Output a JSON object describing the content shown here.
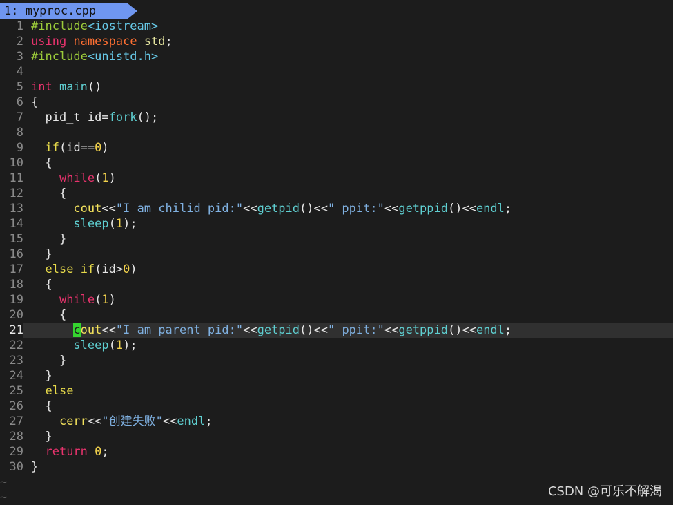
{
  "tab": {
    "label": "1: myproc.cpp"
  },
  "lines": [
    {
      "n": "1",
      "tokens": [
        {
          "t": "#include",
          "c": "pp"
        },
        {
          "t": "<iostream>",
          "c": "hdr"
        }
      ]
    },
    {
      "n": "2",
      "tokens": [
        {
          "t": "using",
          "c": "kw"
        },
        {
          "t": " ",
          "c": ""
        },
        {
          "t": "namespace",
          "c": "ty"
        },
        {
          "t": " ",
          "c": ""
        },
        {
          "t": "std",
          "c": "std"
        },
        {
          "t": ";",
          "c": ""
        }
      ]
    },
    {
      "n": "3",
      "tokens": [
        {
          "t": "#include",
          "c": "pp"
        },
        {
          "t": "<unistd.h>",
          "c": "hdr"
        }
      ]
    },
    {
      "n": "4",
      "tokens": []
    },
    {
      "n": "5",
      "tokens": [
        {
          "t": "int",
          "c": "kw"
        },
        {
          "t": " ",
          "c": ""
        },
        {
          "t": "main",
          "c": "fn"
        },
        {
          "t": "()",
          "c": ""
        }
      ]
    },
    {
      "n": "6",
      "tokens": [
        {
          "t": "{",
          "c": ""
        }
      ]
    },
    {
      "n": "7",
      "tokens": [
        {
          "t": "  pid_t id=",
          "c": ""
        },
        {
          "t": "fork",
          "c": "fn"
        },
        {
          "t": "();",
          "c": ""
        }
      ]
    },
    {
      "n": "8",
      "tokens": []
    },
    {
      "n": "9",
      "tokens": [
        {
          "t": "  ",
          "c": ""
        },
        {
          "t": "if",
          "c": "ctl"
        },
        {
          "t": "(id==",
          "c": ""
        },
        {
          "t": "0",
          "c": "num"
        },
        {
          "t": ")",
          "c": ""
        }
      ]
    },
    {
      "n": "10",
      "tokens": [
        {
          "t": "  {",
          "c": ""
        }
      ]
    },
    {
      "n": "11",
      "tokens": [
        {
          "t": "    ",
          "c": ""
        },
        {
          "t": "while",
          "c": "kw"
        },
        {
          "t": "(",
          "c": ""
        },
        {
          "t": "1",
          "c": "num"
        },
        {
          "t": ")",
          "c": ""
        }
      ]
    },
    {
      "n": "12",
      "tokens": [
        {
          "t": "    {",
          "c": ""
        }
      ]
    },
    {
      "n": "13",
      "tokens": [
        {
          "t": "      ",
          "c": ""
        },
        {
          "t": "cout",
          "c": "io"
        },
        {
          "t": "<<",
          "c": ""
        },
        {
          "t": "\"I am chilid pid:\"",
          "c": "str"
        },
        {
          "t": "<<",
          "c": ""
        },
        {
          "t": "getpid",
          "c": "fn"
        },
        {
          "t": "()<<",
          "c": ""
        },
        {
          "t": "\" ppit:\"",
          "c": "str"
        },
        {
          "t": "<<",
          "c": ""
        },
        {
          "t": "getppid",
          "c": "fn"
        },
        {
          "t": "()<<",
          "c": ""
        },
        {
          "t": "endl",
          "c": "fn"
        },
        {
          "t": ";",
          "c": ""
        }
      ]
    },
    {
      "n": "14",
      "tokens": [
        {
          "t": "      ",
          "c": ""
        },
        {
          "t": "sleep",
          "c": "fn"
        },
        {
          "t": "(",
          "c": ""
        },
        {
          "t": "1",
          "c": "num"
        },
        {
          "t": ");",
          "c": ""
        }
      ]
    },
    {
      "n": "15",
      "tokens": [
        {
          "t": "    }",
          "c": ""
        }
      ]
    },
    {
      "n": "16",
      "tokens": [
        {
          "t": "  }",
          "c": ""
        }
      ]
    },
    {
      "n": "17",
      "tokens": [
        {
          "t": "  ",
          "c": ""
        },
        {
          "t": "else",
          "c": "ctl"
        },
        {
          "t": " ",
          "c": ""
        },
        {
          "t": "if",
          "c": "ctl"
        },
        {
          "t": "(id>",
          "c": ""
        },
        {
          "t": "0",
          "c": "num"
        },
        {
          "t": ")",
          "c": ""
        }
      ]
    },
    {
      "n": "18",
      "tokens": [
        {
          "t": "  {",
          "c": ""
        }
      ]
    },
    {
      "n": "19",
      "tokens": [
        {
          "t": "    ",
          "c": ""
        },
        {
          "t": "while",
          "c": "kw"
        },
        {
          "t": "(",
          "c": ""
        },
        {
          "t": "1",
          "c": "num"
        },
        {
          "t": ")",
          "c": ""
        }
      ]
    },
    {
      "n": "20",
      "tokens": [
        {
          "t": "    {",
          "c": ""
        }
      ]
    },
    {
      "n": "21",
      "current": true,
      "tokens": [
        {
          "t": "      ",
          "c": ""
        },
        {
          "t": "c",
          "c": "cur"
        },
        {
          "t": "out",
          "c": "io"
        },
        {
          "t": "<<",
          "c": ""
        },
        {
          "t": "\"I am parent pid:\"",
          "c": "str"
        },
        {
          "t": "<<",
          "c": ""
        },
        {
          "t": "getpid",
          "c": "fn"
        },
        {
          "t": "()<<",
          "c": ""
        },
        {
          "t": "\" ppit:\"",
          "c": "str"
        },
        {
          "t": "<<",
          "c": ""
        },
        {
          "t": "getppid",
          "c": "fn"
        },
        {
          "t": "()<<",
          "c": ""
        },
        {
          "t": "endl",
          "c": "fn"
        },
        {
          "t": ";",
          "c": ""
        }
      ]
    },
    {
      "n": "22",
      "tokens": [
        {
          "t": "      ",
          "c": ""
        },
        {
          "t": "sleep",
          "c": "fn"
        },
        {
          "t": "(",
          "c": ""
        },
        {
          "t": "1",
          "c": "num"
        },
        {
          "t": ");",
          "c": ""
        }
      ]
    },
    {
      "n": "23",
      "tokens": [
        {
          "t": "    }",
          "c": ""
        }
      ]
    },
    {
      "n": "24",
      "tokens": [
        {
          "t": "  }",
          "c": ""
        }
      ]
    },
    {
      "n": "25",
      "tokens": [
        {
          "t": "  ",
          "c": ""
        },
        {
          "t": "else",
          "c": "ctl"
        }
      ]
    },
    {
      "n": "26",
      "tokens": [
        {
          "t": "  {",
          "c": ""
        }
      ]
    },
    {
      "n": "27",
      "tokens": [
        {
          "t": "    ",
          "c": ""
        },
        {
          "t": "cerr",
          "c": "io"
        },
        {
          "t": "<<",
          "c": ""
        },
        {
          "t": "\"创建失败\"",
          "c": "str"
        },
        {
          "t": "<<",
          "c": ""
        },
        {
          "t": "endl",
          "c": "fn"
        },
        {
          "t": ";",
          "c": ""
        }
      ]
    },
    {
      "n": "28",
      "tokens": [
        {
          "t": "  }",
          "c": ""
        }
      ]
    },
    {
      "n": "29",
      "tokens": [
        {
          "t": "  ",
          "c": ""
        },
        {
          "t": "return",
          "c": "kw"
        },
        {
          "t": " ",
          "c": ""
        },
        {
          "t": "0",
          "c": "num"
        },
        {
          "t": ";",
          "c": ""
        }
      ]
    },
    {
      "n": "30",
      "tokens": [
        {
          "t": "}",
          "c": ""
        }
      ]
    }
  ],
  "tildes": [
    "~",
    "~"
  ],
  "watermark": "CSDN @可乐不解渴"
}
